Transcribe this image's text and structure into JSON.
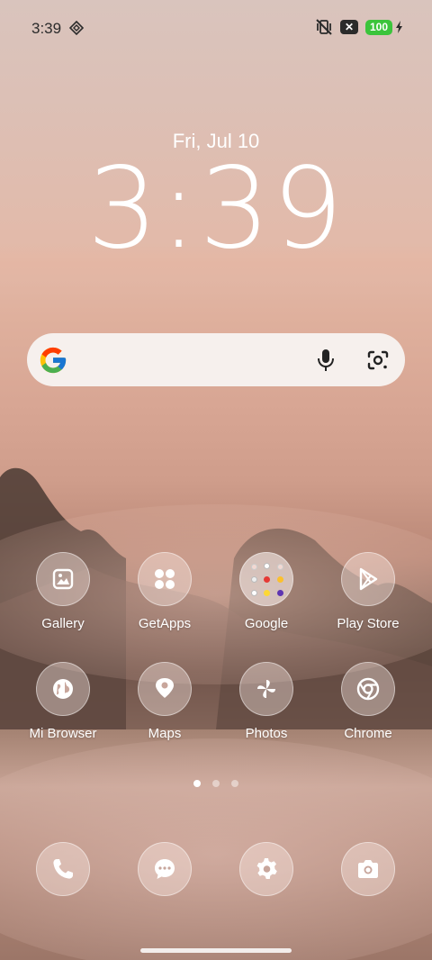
{
  "status_bar": {
    "time": "3:39",
    "battery": "100",
    "sim_label": "✕"
  },
  "clock_widget": {
    "date": "Fri, Jul 10",
    "time": "3:39"
  },
  "search_bar": {
    "logo": "google-logo",
    "voice_icon": "mic-icon",
    "lens_icon": "lens-icon"
  },
  "apps": [
    {
      "label": "Gallery",
      "icon": "image-icon"
    },
    {
      "label": "GetApps",
      "icon": "grid-icon"
    },
    {
      "label": "Google",
      "icon": "folder"
    },
    {
      "label": "Play Store",
      "icon": "play-icon"
    },
    {
      "label": "Mi Browser",
      "icon": "globe-icon"
    },
    {
      "label": "Maps",
      "icon": "map-pin-icon"
    },
    {
      "label": "Photos",
      "icon": "pinwheel-icon"
    },
    {
      "label": "Chrome",
      "icon": "chrome-icon"
    }
  ],
  "page_indicator": {
    "pages": 3,
    "current": 1
  },
  "dock": [
    {
      "icon": "phone-icon"
    },
    {
      "icon": "messages-icon"
    },
    {
      "icon": "settings-icon"
    },
    {
      "icon": "camera-icon"
    }
  ],
  "colors": {
    "battery_green": "#3bc43b",
    "icon_white": "#ffffff"
  }
}
